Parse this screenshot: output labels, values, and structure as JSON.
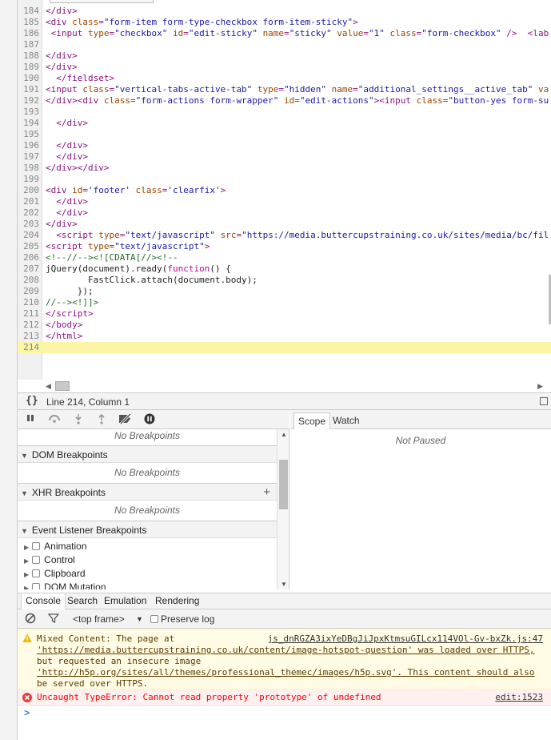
{
  "editor": {
    "current_line": 214,
    "lines": [
      {
        "n": "184",
        "html": "<span class='t-tag'>&lt;/div&gt;</span>"
      },
      {
        "n": "185",
        "html": "<span class='t-tag'>&lt;div </span><span class='t-attr'>class</span><span class='t-tag'>=</span><span class='t-val'>\"form-item form-type-checkbox form-item-sticky\"</span><span class='t-tag'>&gt;</span>"
      },
      {
        "n": "186",
        "html": " <span class='t-tag'>&lt;input </span><span class='t-attr'>type</span><span class='t-tag'>=</span><span class='t-val'>\"checkbox\"</span> <span class='t-attr'>id</span><span class='t-tag'>=</span><span class='t-val'>\"edit-sticky\"</span> <span class='t-attr'>name</span><span class='t-tag'>=</span><span class='t-val'>\"sticky\"</span> <span class='t-attr'>value</span><span class='t-tag'>=</span><span class='t-val'>\"1\"</span> <span class='t-attr'>class</span><span class='t-tag'>=</span><span class='t-val'>\"form-checkbox\"</span> <span class='t-tag'>/&gt;</span>  <span class='t-tag'>&lt;lab</span>"
      },
      {
        "n": "187",
        "html": ""
      },
      {
        "n": "188",
        "html": "<span class='t-tag'>&lt;/div&gt;</span>"
      },
      {
        "n": "189",
        "html": "<span class='t-tag'>&lt;/div&gt;</span>"
      },
      {
        "n": "190",
        "html": "  <span class='t-tag'>&lt;/fieldset&gt;</span>"
      },
      {
        "n": "191",
        "html": "<span class='t-tag'>&lt;input </span><span class='t-attr'>class</span><span class='t-tag'>=</span><span class='t-val'>\"vertical-tabs-active-tab\"</span> <span class='t-attr'>type</span><span class='t-tag'>=</span><span class='t-val'>\"hidden\"</span> <span class='t-attr'>name</span><span class='t-tag'>=</span><span class='t-val'>\"additional_settings__active_tab\"</span> <span class='t-attr'>va</span>"
      },
      {
        "n": "192",
        "html": "<span class='t-tag'>&lt;/div&gt;&lt;div </span><span class='t-attr'>class</span><span class='t-tag'>=</span><span class='t-val'>\"form-actions form-wrapper\"</span> <span class='t-attr'>id</span><span class='t-tag'>=</span><span class='t-val'>\"edit-actions\"</span><span class='t-tag'>&gt;&lt;input </span><span class='t-attr'>class</span><span class='t-tag'>=</span><span class='t-val'>\"button-yes form-su</span>"
      },
      {
        "n": "193",
        "html": ""
      },
      {
        "n": "194",
        "html": "  <span class='t-tag'>&lt;/div&gt;</span>"
      },
      {
        "n": "195",
        "html": ""
      },
      {
        "n": "196",
        "html": "  <span class='t-tag'>&lt;/div&gt;</span>"
      },
      {
        "n": "197",
        "html": "  <span class='t-tag'>&lt;/div&gt;</span>"
      },
      {
        "n": "198",
        "html": "<span class='t-tag'>&lt;/div&gt;&lt;/div&gt;</span>"
      },
      {
        "n": "199",
        "html": ""
      },
      {
        "n": "200",
        "html": "<span class='t-tag'>&lt;div </span><span class='t-attr'>id</span><span class='t-tag'>=</span><span class='t-val'>'footer'</span> <span class='t-attr'>class</span><span class='t-tag'>=</span><span class='t-val'>'clearfix'</span><span class='t-tag'>&gt;</span>"
      },
      {
        "n": "201",
        "html": "  <span class='t-tag'>&lt;/div&gt;</span>"
      },
      {
        "n": "202",
        "html": "  <span class='t-tag'>&lt;/div&gt;</span>"
      },
      {
        "n": "203",
        "html": "<span class='t-tag'>&lt;/div&gt;</span>"
      },
      {
        "n": "204",
        "html": "  <span class='t-tag'>&lt;script </span><span class='t-attr'>type</span><span class='t-tag'>=</span><span class='t-val'>\"text/javascript\"</span> <span class='t-attr'>src</span><span class='t-tag'>=</span><span class='t-val'>\"https://media.buttercupstraining.co.uk/sites/media/bc/fil</span>"
      },
      {
        "n": "205",
        "html": "<span class='t-tag'>&lt;script </span><span class='t-attr'>type</span><span class='t-tag'>=</span><span class='t-val'>\"text/javascript\"</span><span class='t-tag'>&gt;</span>"
      },
      {
        "n": "206",
        "html": "<span class='t-com'>&lt;!--//--&gt;&lt;![CDATA[//&gt;&lt;!--</span>"
      },
      {
        "n": "207",
        "html": "<span class='t-plain'>jQuery(document).ready(</span><span class='t-kw'>function</span><span class='t-plain'>() {</span>"
      },
      {
        "n": "208",
        "html": "<span class='t-plain'>        FastClick.attach(document.body);</span>"
      },
      {
        "n": "209",
        "html": "<span class='t-plain'>      });</span>"
      },
      {
        "n": "210",
        "html": "<span class='t-com'>//--&gt;&lt;!]]&gt;</span>"
      },
      {
        "n": "211",
        "html": "<span class='t-tag'>&lt;/script&gt;</span>"
      },
      {
        "n": "212",
        "html": "<span class='t-tag'>&lt;/body&gt;</span>"
      },
      {
        "n": "213",
        "html": "<span class='t-tag'>&lt;/html&gt;</span>"
      },
      {
        "n": "214",
        "html": ""
      }
    ]
  },
  "statusbar": {
    "braces": "{}",
    "position": "Line 214, Column 1"
  },
  "scope": {
    "tabs": [
      "Scope",
      "Watch"
    ],
    "not_paused": "Not Paused"
  },
  "sidebar": {
    "no_breakpoints_top": "No Breakpoints",
    "dom_header": "DOM Breakpoints",
    "dom_empty": "No Breakpoints",
    "xhr_header": "XHR Breakpoints",
    "xhr_empty": "No Breakpoints",
    "event_header": "Event Listener Breakpoints",
    "event_items": [
      "Animation",
      "Control",
      "Clipboard",
      "DOM Mutation"
    ]
  },
  "drawer": {
    "tabs": [
      "Console",
      "Search",
      "Emulation",
      "Rendering"
    ]
  },
  "console_toolbar": {
    "frame": "<top frame>",
    "preserve_log": "Preserve log"
  },
  "console": {
    "warning_lines": [
      "Mixed Content: The page at",
      "'https://media.buttercupstraining.co.uk/content/image-hotspot-question' was loaded over HTTPS,",
      "but requested an insecure image",
      "'http://h5p.org/sites/all/themes/professional_themec/images/h5p.svg'. This content should also",
      "be served over HTTPS."
    ],
    "warning_source": "js_dnRGZA3ixYeDBgJiJpxKtmsuGILcx114VOl-Gv-bxZk.js:47",
    "error_text": "Uncaught TypeError: Cannot read property 'prototype' of undefined",
    "error_source": "edit:1523",
    "prompt": ">"
  },
  "colors": {
    "current_line": "#fbf5a5",
    "warning_bg": "#fffbe5",
    "error_text": "#ff0000",
    "warn_icon": "#f0b400",
    "error_icon": "#e0403a"
  }
}
